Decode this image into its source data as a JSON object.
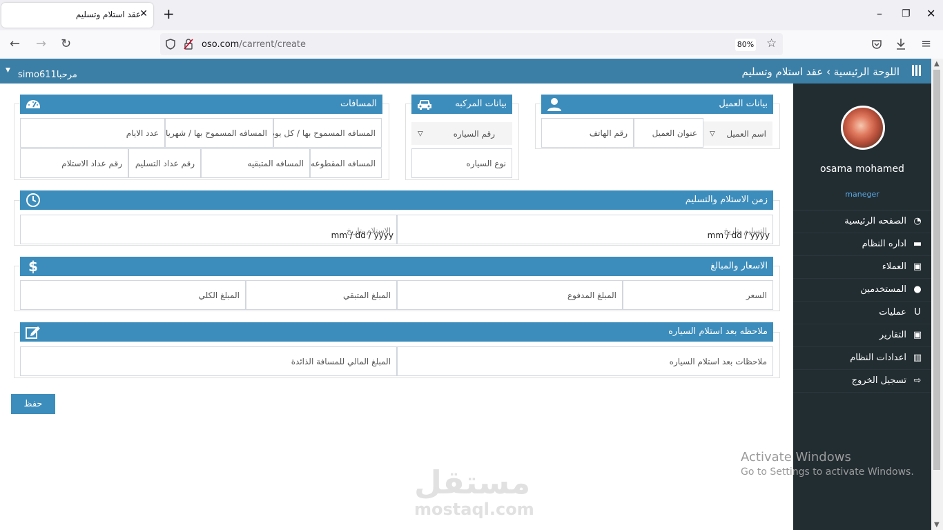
{
  "browser": {
    "tab_title": "عقد استلام وتسليم",
    "tab_close": "✕",
    "new_tab": "+",
    "url_domain": "oso.com",
    "url_path": "/carrent/create",
    "zoom": "80%"
  },
  "header": {
    "breadcrumb_home": "اللوحة الرئيسية",
    "breadcrumb_sep": "›",
    "breadcrumb_current": "عقد استلام وتسليم",
    "greeting": "مرحباsimo611",
    "caret": "▼"
  },
  "sidebar": {
    "user_name": "osama mohamed",
    "user_role": "maneger",
    "items": [
      {
        "label": "الصفحه الرئيسية",
        "icon": "tachometer-icon"
      },
      {
        "label": "اداره النظام",
        "icon": "credit-card-icon"
      },
      {
        "label": "العملاء",
        "icon": "id-card-icon"
      },
      {
        "label": "المستخدمين",
        "icon": "user-icon"
      },
      {
        "label": "عمليات",
        "icon": "magnet-icon"
      },
      {
        "label": "التقارير",
        "icon": "id-card-icon"
      },
      {
        "label": "اعدادات النظام",
        "icon": "chart-icon"
      },
      {
        "label": "تسجيل الخروج",
        "icon": "sign-out-icon"
      }
    ]
  },
  "customer": {
    "title": "بيانات العميل",
    "name_select": "اسم العميل",
    "address": "عنوان العميل",
    "phone": "رقم الهاتف"
  },
  "vehicle": {
    "title": "بيانات المركبه",
    "number_select": "رقم السياره",
    "type": "نوع السياره"
  },
  "distances": {
    "title": "المسافات",
    "allowed_daily": "المسافه المسموح بها / كل يوم",
    "allowed_monthly": "المسافه المسموح بها / شهريا",
    "days": "عدد الايام",
    "traveled": "المسافه المقطوعه",
    "remaining": "المسافه المتبقيه",
    "delivery_counter": "رقم عداد التسليم",
    "receipt_counter": "رقم عداد الاستلام"
  },
  "time": {
    "title": "زمن الاستلام والتسليم",
    "delivery_date": "التسليم بتاريخ",
    "receipt_date": "الاستلام بتاريخ",
    "date_format": "mm / dd / yyyy"
  },
  "prices": {
    "title": "الاسعار والمبالغ",
    "price": "السعر",
    "paid": "المبلغ المدفوع",
    "remaining": "المبلغ المتبقي",
    "total": "المبلغ الكلي"
  },
  "notes": {
    "title": "ملاحظه بعد استلام السياره",
    "notes_after": "ملاحظات بعد استلام السياره",
    "excess_amount": "المبلغ المالي للمسافة الذائدة"
  },
  "save_label": "حفظ",
  "os_notice": {
    "line1": "Activate Windows",
    "line2": "Go to Settings to activate Windows."
  },
  "watermark": {
    "arabic": "مستقل",
    "latin": "mostaql.com"
  },
  "colors": {
    "header": "#3c7fa6",
    "panel_head": "#3c8dbc",
    "sidebar": "#222d32",
    "role": "#5aa9e6"
  }
}
